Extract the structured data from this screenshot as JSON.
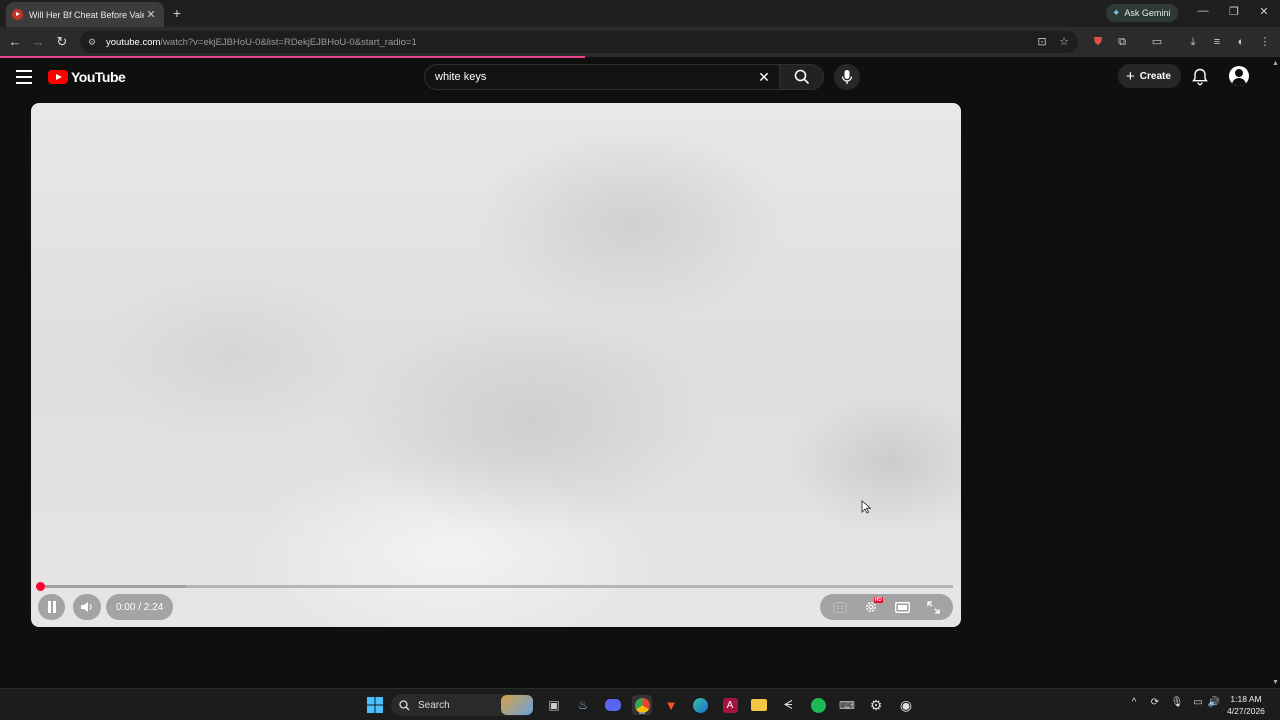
{
  "browser": {
    "tab_title": "Will Her Bf Cheat Before Valentin",
    "ask_gemini": "Ask Gemini",
    "url_host": "youtube.com",
    "url_path": "/watch?v=ekjEJBHoU-0&list=RDekjEJBHoU-0&start_radio=1",
    "loading_progress": 0.457
  },
  "youtube": {
    "logo_text": "YouTube",
    "search_value": "white keys",
    "create_label": "Create"
  },
  "player": {
    "time_display": "0:00 / 2:24",
    "played_fraction": 0.0,
    "buffered_fraction": 0.16,
    "hd_badge": "HD"
  },
  "taskbar": {
    "search_label": "Search",
    "time": "1:18 AM",
    "date": "4/27/2026"
  },
  "colors": {
    "accent_red": "#ff0033",
    "youtube_red": "#ff0000",
    "load_bar": "#e8448b"
  }
}
